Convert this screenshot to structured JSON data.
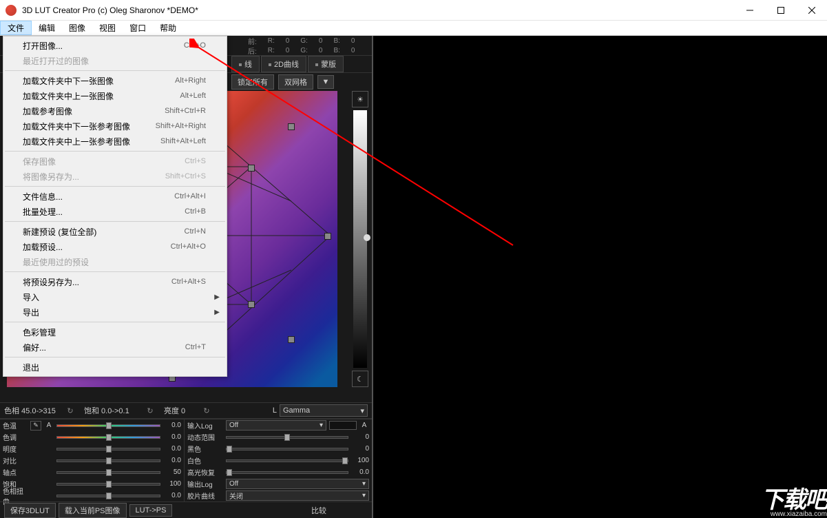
{
  "window": {
    "title": "3D LUT Creator Pro (c) Oleg Sharonov *DEMO*"
  },
  "menubar": {
    "items": [
      {
        "label": "文件"
      },
      {
        "label": "编辑"
      },
      {
        "label": "图像"
      },
      {
        "label": "视图"
      },
      {
        "label": "窗口"
      },
      {
        "label": "帮助"
      }
    ]
  },
  "dropdown": {
    "items": [
      {
        "label": "打开图像...",
        "shortcut": "Ctrl+O",
        "type": "item"
      },
      {
        "label": "最近打开过的图像",
        "type": "item",
        "disabled": true
      },
      {
        "type": "sep"
      },
      {
        "label": "加载文件夹中下一张图像",
        "shortcut": "Alt+Right",
        "type": "item"
      },
      {
        "label": "加载文件夹中上一张图像",
        "shortcut": "Alt+Left",
        "type": "item"
      },
      {
        "label": "加载参考图像",
        "shortcut": "Shift+Ctrl+R",
        "type": "item"
      },
      {
        "label": "加载文件夹中下一张参考图像",
        "shortcut": "Shift+Alt+Right",
        "type": "item"
      },
      {
        "label": "加载文件夹中上一张参考图像",
        "shortcut": "Shift+Alt+Left",
        "type": "item"
      },
      {
        "type": "sep"
      },
      {
        "label": "保存图像",
        "shortcut": "Ctrl+S",
        "type": "item",
        "disabled": true
      },
      {
        "label": "将图像另存为...",
        "shortcut": "Shift+Ctrl+S",
        "type": "item",
        "disabled": true
      },
      {
        "type": "sep"
      },
      {
        "label": "文件信息...",
        "shortcut": "Ctrl+Alt+I",
        "type": "item"
      },
      {
        "label": "批量处理...",
        "shortcut": "Ctrl+B",
        "type": "item"
      },
      {
        "type": "sep"
      },
      {
        "label": "新建预设 (复位全部)",
        "shortcut": "Ctrl+N",
        "type": "item"
      },
      {
        "label": "加载预设...",
        "shortcut": "Ctrl+Alt+O",
        "type": "item"
      },
      {
        "label": "最近使用过的预设",
        "type": "item",
        "disabled": true
      },
      {
        "type": "sep"
      },
      {
        "label": "将预设另存为...",
        "shortcut": "Ctrl+Alt+S",
        "type": "item"
      },
      {
        "label": "导入",
        "type": "sub"
      },
      {
        "label": "导出",
        "type": "sub"
      },
      {
        "type": "sep"
      },
      {
        "label": "色彩管理",
        "type": "item"
      },
      {
        "label": "偏好...",
        "shortcut": "Ctrl+T",
        "type": "item"
      },
      {
        "type": "sep"
      },
      {
        "label": "退出",
        "type": "item"
      }
    ]
  },
  "info": {
    "before_label": "前:",
    "after_label": "后:",
    "r_label": "R:",
    "g_label": "G:",
    "b_label": "B:",
    "val": "0"
  },
  "tabs": {
    "items": [
      {
        "label": "线"
      },
      {
        "label": "2D曲线"
      },
      {
        "label": "蒙版"
      }
    ]
  },
  "subrow": {
    "lock_all": "锁定所有",
    "dual_grid": "双网格"
  },
  "ctrl": {
    "hue": "色相 45.0->315",
    "sat": "饱和 0.0->0.1",
    "lum": "亮度  0",
    "l_label": "L",
    "gamma": "Gamma"
  },
  "sliders_left": [
    {
      "label": "色温",
      "val": "0.0",
      "rainbow": true,
      "pos": 50
    },
    {
      "label": "色调",
      "val": "0.0",
      "rainbow": true,
      "pos": 50
    },
    {
      "label": "明度",
      "val": "0.0",
      "pos": 50
    },
    {
      "label": "对比",
      "val": "0.0",
      "pos": 50
    },
    {
      "label": "轴点",
      "val": "50",
      "pos": 50
    },
    {
      "label": "饱和",
      "val": "100",
      "pos": 50
    },
    {
      "label": "色相扭曲",
      "val": "0.0",
      "pos": 50
    }
  ],
  "sliders_right": [
    {
      "label": "输入Log",
      "type": "dd",
      "val": "Off"
    },
    {
      "label": "动态范围",
      "type": "sl",
      "val": "0",
      "pos": 50
    },
    {
      "label": "黑色",
      "type": "sl",
      "val": "0",
      "pos": 2
    },
    {
      "label": "白色",
      "type": "sl",
      "val": "100",
      "pos": 98
    },
    {
      "label": "高光恢复",
      "type": "sl",
      "val": "0.0",
      "pos": 2
    },
    {
      "label": "输出Log",
      "type": "dd",
      "val": "Off"
    },
    {
      "label": "胶片曲线",
      "type": "dd",
      "val": "关闭"
    }
  ],
  "right_letter": "A",
  "left_letter": "A",
  "bottom": {
    "save_lut": "保存3DLUT",
    "load_ps": "载入当前PS图像",
    "lut_to_ps": "LUT->PS",
    "compare": "比较"
  },
  "watermark": {
    "big": "下载吧",
    "url": "www.xiazaiba.com"
  }
}
